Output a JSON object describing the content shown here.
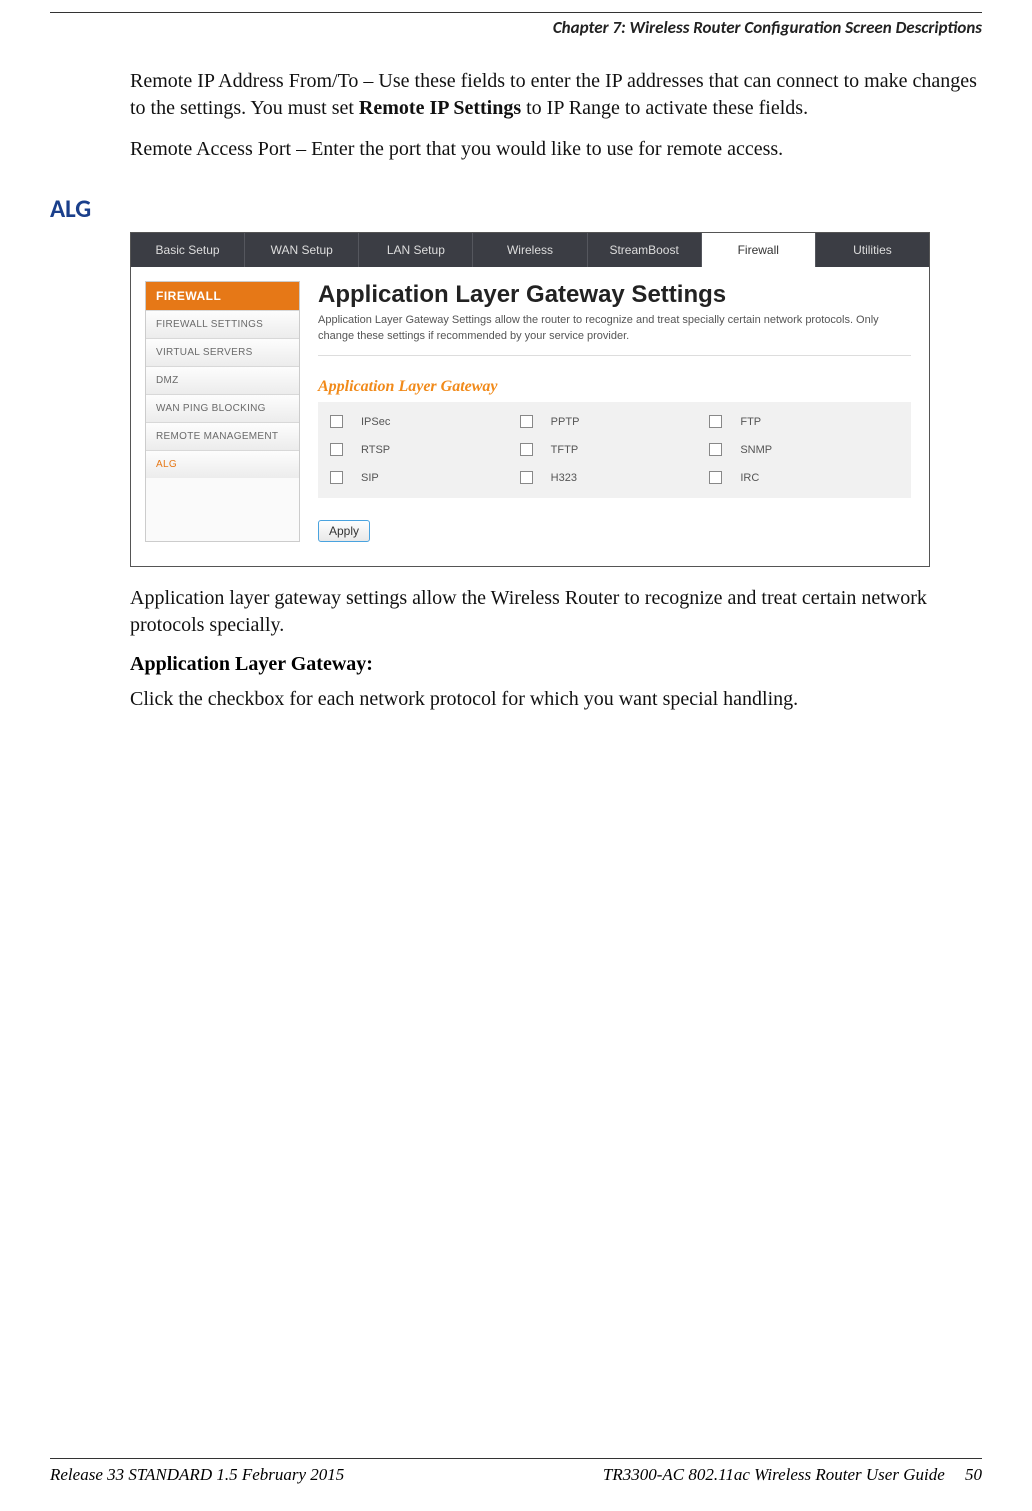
{
  "header": {
    "chapter": "Chapter 7: Wireless Router Configuration Screen Descriptions"
  },
  "para1_a": "Remote IP Address From/To – Use these fields to enter the IP addresses that can connect to make changes to the settings. You must set ",
  "para1_bold": "Remote IP Settings",
  "para1_b": " to IP Range to activate these fields.",
  "para2": "Remote Access Port – Enter the port that you would like to use for remote access.",
  "section": "ALG",
  "shot": {
    "tabs": [
      "Basic Setup",
      "WAN Setup",
      "LAN Setup",
      "Wireless",
      "StreamBoost",
      "Firewall",
      "Utilities"
    ],
    "tabs_active_index": 5,
    "sidebar_head": "FIREWALL",
    "sidebar_items": [
      "FIREWALL SETTINGS",
      "VIRTUAL SERVERS",
      "DMZ",
      "WAN PING BLOCKING",
      "REMOTE MANAGEMENT",
      "ALG"
    ],
    "sidebar_active_index": 5,
    "title": "Application Layer Gateway Settings",
    "desc": "Application Layer Gateway Settings allow the router to recognize and treat specially certain network protocols. Only change these settings if recommended by your service provider.",
    "subhead": "Application Layer Gateway",
    "protocols": {
      "row0": {
        "c0": "IPSec",
        "c1": "PPTP",
        "c2": "FTP"
      },
      "row1": {
        "c0": "RTSP",
        "c1": "TFTP",
        "c2": "SNMP"
      },
      "row2": {
        "c0": "SIP",
        "c1": "H323",
        "c2": "IRC"
      }
    },
    "apply": "Apply"
  },
  "after1": "Application layer gateway settings allow the Wireless Router to recognize and treat certain network protocols specially.",
  "after_bold": "Application Layer Gateway:",
  "after2": "Click the checkbox for each network protocol for which you want special handling.",
  "footer": {
    "left": "Release 33 STANDARD 1.5    February 2015",
    "right": "TR3300-AC 802.11ac Wireless Router User Guide",
    "page": "50"
  }
}
